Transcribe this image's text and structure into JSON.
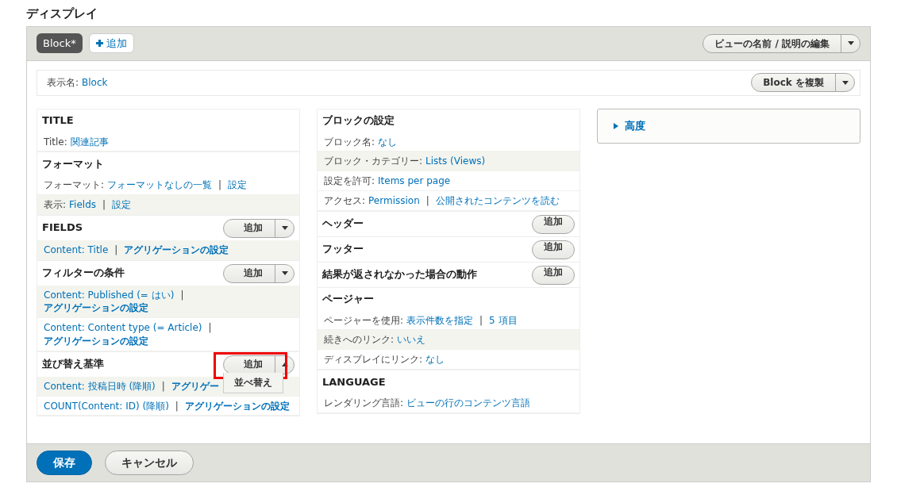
{
  "heading": "ディスプレイ",
  "display_tabs": [
    {
      "label": "Block*",
      "selected": true
    }
  ],
  "add_display_button": "追加",
  "edit_view_button": "ビューの名前 / 説明の編集",
  "display_name": {
    "label": "表示名:",
    "value": "Block",
    "duplicate_button": "Block を複製"
  },
  "columns": [
    [
      {
        "title": "TITLE",
        "rows": [
          {
            "striped": false,
            "parts": [
              {
                "kind": "label",
                "text": "Title:"
              },
              {
                "kind": "link",
                "text": "関連記事"
              }
            ]
          }
        ]
      },
      {
        "title": "フォーマット",
        "rows": [
          {
            "striped": false,
            "parts": [
              {
                "kind": "label",
                "text": "フォーマット:"
              },
              {
                "kind": "link",
                "text": "フォーマットなしの一覧"
              },
              {
                "kind": "separator",
                "text": "|"
              },
              {
                "kind": "link",
                "text": "設定"
              }
            ]
          },
          {
            "striped": true,
            "parts": [
              {
                "kind": "label",
                "text": "表示:"
              },
              {
                "kind": "link",
                "text": "Fields"
              },
              {
                "kind": "separator",
                "text": "|"
              },
              {
                "kind": "link",
                "text": "設定"
              }
            ]
          }
        ]
      },
      {
        "title": "FIELDS",
        "add_button": {
          "label": "追加",
          "split": true
        },
        "rows": [
          {
            "striped": true,
            "parts": [
              {
                "kind": "link",
                "text": "Content: Title"
              },
              {
                "kind": "separator",
                "text": "|"
              },
              {
                "kind": "bold_link",
                "text": "アグリゲーションの設定"
              }
            ]
          }
        ]
      },
      {
        "title": "フィルターの条件",
        "add_button": {
          "label": "追加",
          "split": true
        },
        "rows": [
          {
            "striped": true,
            "parts": [
              {
                "kind": "link",
                "text": "Content: Published (= はい)"
              },
              {
                "kind": "separator",
                "text": "|"
              },
              {
                "kind": "bold_link",
                "text": "アグリゲーションの設定"
              }
            ]
          },
          {
            "striped": false,
            "parts": [
              {
                "kind": "link",
                "text": "Content: Content type (= Article)"
              },
              {
                "kind": "separator",
                "text": "|"
              },
              {
                "kind": "bold_link",
                "text": "アグリゲーションの設定"
              }
            ]
          }
        ]
      },
      {
        "title": "並び替え基準",
        "add_button": {
          "label": "追加",
          "split": true,
          "menu_open": true,
          "menu_items": [
            {
              "label": "並べ替え",
              "highlighted": true
            }
          ]
        },
        "rows": [
          {
            "striped": true,
            "parts": [
              {
                "kind": "link",
                "text": "Content: 投稿日時 (降順)"
              },
              {
                "kind": "separator",
                "text": "|"
              },
              {
                "kind": "bold_link",
                "text": "アグリゲー"
              }
            ]
          },
          {
            "striped": false,
            "parts": [
              {
                "kind": "link",
                "text": "COUNT(Content: ID) (降順)"
              },
              {
                "kind": "separator",
                "text": "|"
              },
              {
                "kind": "bold_link",
                "text": "アグリゲーションの設定"
              }
            ]
          }
        ]
      }
    ],
    [
      {
        "title": "ブロックの設定",
        "rows": [
          {
            "striped": false,
            "parts": [
              {
                "kind": "label",
                "text": "ブロック名:"
              },
              {
                "kind": "link",
                "text": "なし"
              }
            ]
          },
          {
            "striped": true,
            "parts": [
              {
                "kind": "label",
                "text": "ブロック・カテゴリー:"
              },
              {
                "kind": "link",
                "text": "Lists (Views)"
              }
            ]
          },
          {
            "striped": false,
            "parts": [
              {
                "kind": "label",
                "text": "設定を許可:"
              },
              {
                "kind": "link",
                "text": "Items per page"
              }
            ]
          },
          {
            "striped": false,
            "parts": [
              {
                "kind": "label",
                "text": "アクセス:"
              },
              {
                "kind": "link",
                "text": "Permission"
              },
              {
                "kind": "separator",
                "text": "|"
              },
              {
                "kind": "link",
                "text": "公開されたコンテンツを読む"
              }
            ]
          }
        ]
      },
      {
        "title": "ヘッダー",
        "add_button": {
          "label": "追加",
          "split": false
        }
      },
      {
        "title": "フッター",
        "add_button": {
          "label": "追加",
          "split": false
        }
      },
      {
        "title": "結果が返されなかった場合の動作",
        "add_button": {
          "label": "追加",
          "split": false
        }
      },
      {
        "title": "ページャー",
        "rows": [
          {
            "striped": false,
            "parts": [
              {
                "kind": "label",
                "text": "ページャーを使用:"
              },
              {
                "kind": "link",
                "text": "表示件数を指定"
              },
              {
                "kind": "separator",
                "text": "|"
              },
              {
                "kind": "link",
                "text": "5 項目"
              }
            ]
          },
          {
            "striped": true,
            "parts": [
              {
                "kind": "label",
                "text": "続きへのリンク:"
              },
              {
                "kind": "link",
                "text": "いいえ"
              }
            ]
          },
          {
            "striped": false,
            "parts": [
              {
                "kind": "label",
                "text": "ディスプレイにリンク:"
              },
              {
                "kind": "link",
                "text": "なし"
              }
            ]
          }
        ]
      },
      {
        "title": "LANGUAGE",
        "rows": [
          {
            "striped": false,
            "parts": [
              {
                "kind": "label",
                "text": "レンダリング言語:"
              },
              {
                "kind": "link",
                "text": "ビューの行のコンテンツ言語"
              }
            ]
          }
        ]
      }
    ]
  ],
  "advanced": {
    "label": "高度",
    "expanded": false
  },
  "footer_buttons": [
    {
      "label": "保存",
      "kind": "primary"
    },
    {
      "label": "キャンセル",
      "kind": "secondary"
    }
  ]
}
